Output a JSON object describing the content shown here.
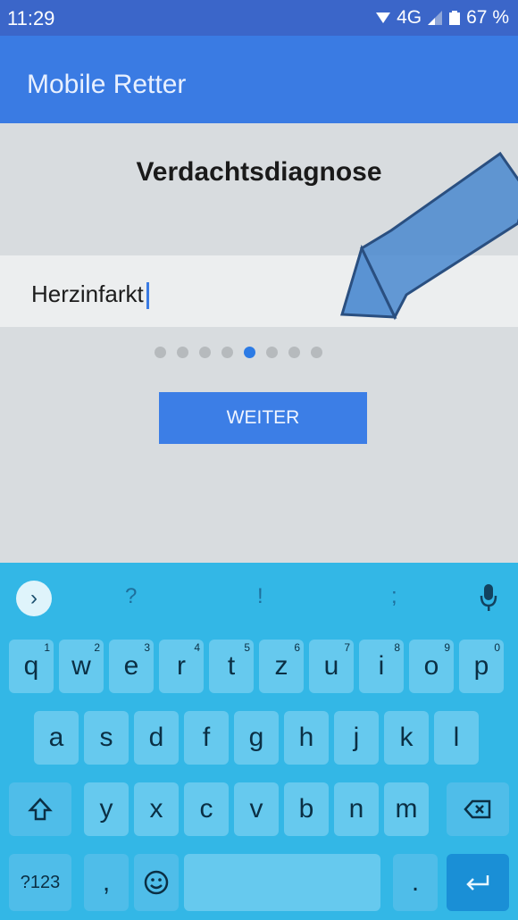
{
  "status": {
    "time": "11:29",
    "network": "4G",
    "battery": "67 %"
  },
  "app": {
    "title": "Mobile Retter"
  },
  "screen": {
    "heading": "Verdachtsdiagnose",
    "input_value": "Herzinfarkt",
    "page_indicator": {
      "total": 8,
      "active_index": 4
    },
    "next_button": "WEITER"
  },
  "keyboard": {
    "suggestions": [
      "?",
      "!",
      ";"
    ],
    "row1": [
      {
        "k": "q",
        "h": "1"
      },
      {
        "k": "w",
        "h": "2"
      },
      {
        "k": "e",
        "h": "3"
      },
      {
        "k": "r",
        "h": "4"
      },
      {
        "k": "t",
        "h": "5"
      },
      {
        "k": "z",
        "h": "6"
      },
      {
        "k": "u",
        "h": "7"
      },
      {
        "k": "i",
        "h": "8"
      },
      {
        "k": "o",
        "h": "9"
      },
      {
        "k": "p",
        "h": "0"
      }
    ],
    "row2": [
      "a",
      "s",
      "d",
      "f",
      "g",
      "h",
      "j",
      "k",
      "l"
    ],
    "row3": [
      "y",
      "x",
      "c",
      "v",
      "b",
      "n",
      "m"
    ],
    "symbols_key": "?123",
    "comma_key": ",",
    "period_key": "."
  },
  "colors": {
    "accent": "#3a7be3",
    "keyboard_bg": "#33b7e6",
    "key_bg": "#66c9ee",
    "annotation_arrow": "#4a88cf"
  }
}
